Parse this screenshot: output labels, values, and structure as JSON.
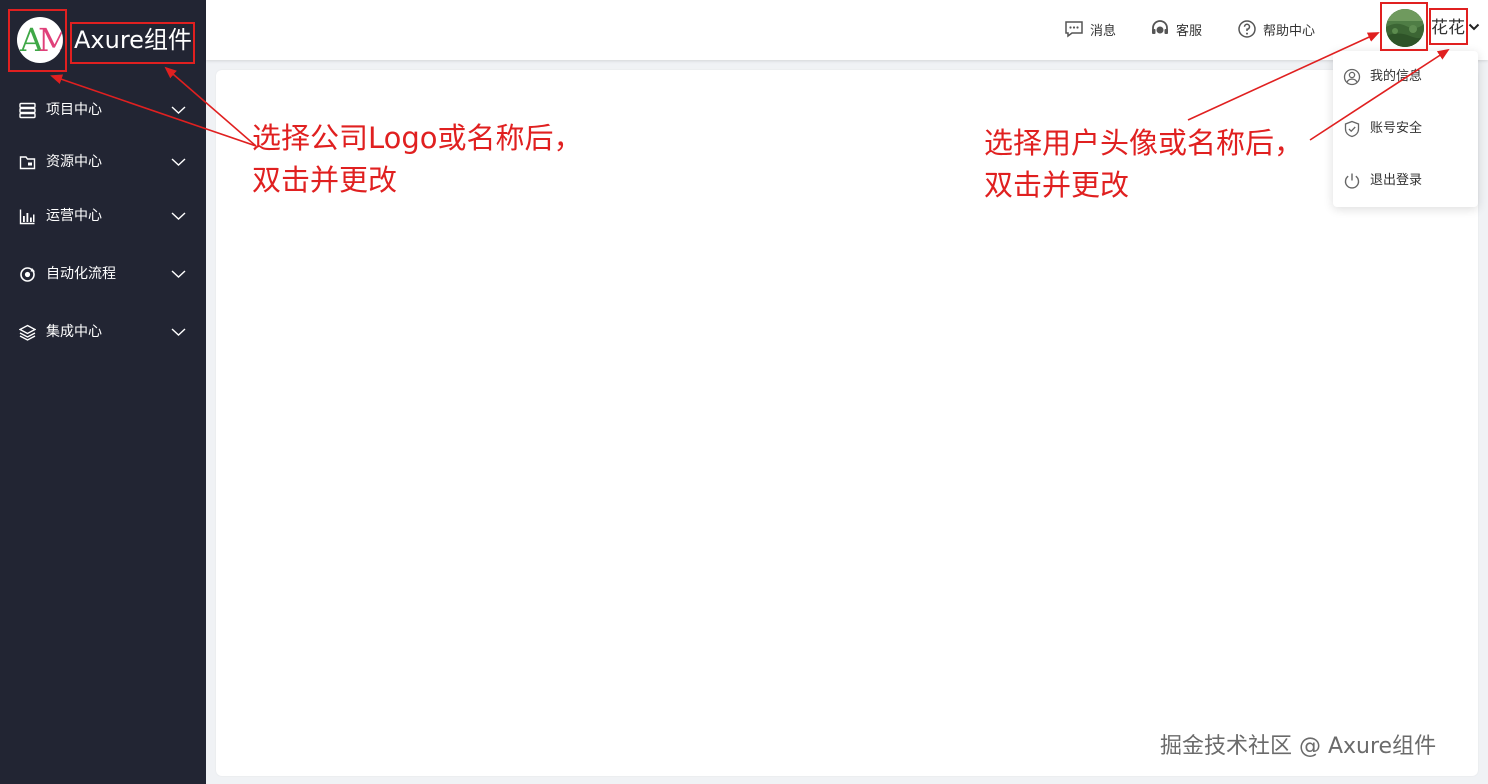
{
  "sidebar": {
    "logo_text": "AM",
    "brand": "Axure组件",
    "menu": [
      {
        "label": "项目中心",
        "icon": "server-icon"
      },
      {
        "label": "资源中心",
        "icon": "folder-icon"
      },
      {
        "label": "运营中心",
        "icon": "bar-chart-icon"
      },
      {
        "label": "自动化流程",
        "icon": "cycle-icon"
      },
      {
        "label": "集成中心",
        "icon": "layers-icon"
      }
    ]
  },
  "header": {
    "messages": "消息",
    "service": "客服",
    "help": "帮助中心",
    "user_name": "花花"
  },
  "user_menu": {
    "items": [
      {
        "label": "我的信息",
        "icon": "user-circle-icon"
      },
      {
        "label": "账号安全",
        "icon": "shield-check-icon"
      },
      {
        "label": "退出登录",
        "icon": "power-icon"
      }
    ]
  },
  "annotations": {
    "left_line1": "选择公司Logo或名称后，",
    "left_line2": "双击并更改",
    "right_line1": "选择用户头像或名称后，",
    "right_line2": "双击并更改",
    "color": "#e02020"
  },
  "watermark": "掘金技术社区 @ Axure组件",
  "colors": {
    "sidebar_bg": "#222533",
    "page_bg": "#f0f2f5",
    "annotation_red": "#e02020"
  }
}
